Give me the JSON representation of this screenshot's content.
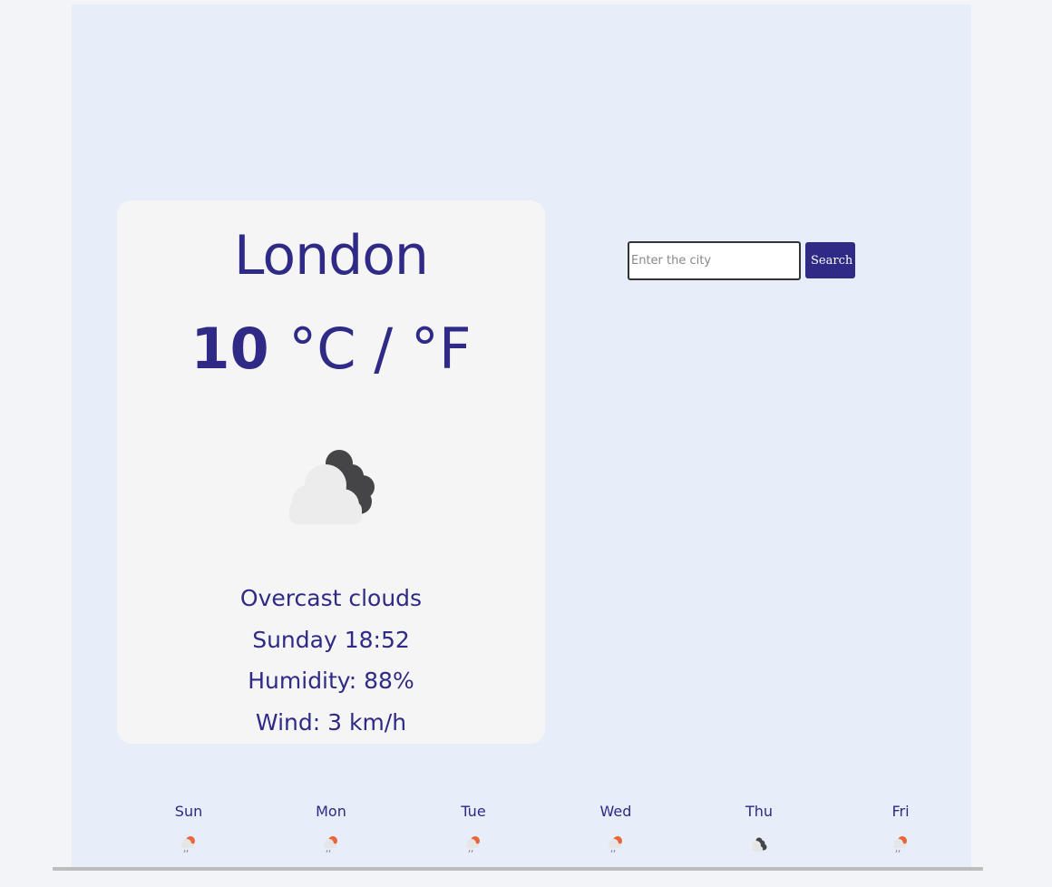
{
  "current": {
    "city": "London",
    "temperature": "10",
    "units": "°C / °F",
    "description": "Overcast clouds",
    "datetime": "Sunday 18:52",
    "humidity": "Humidity: 88%",
    "wind": "Wind: 3 km/h",
    "icon": "cloud-moon-icon"
  },
  "search": {
    "placeholder": "Enter the city",
    "value": "",
    "button_label": "Search"
  },
  "forecast": [
    {
      "day": "Sun",
      "icon": "rain-sun-icon"
    },
    {
      "day": "Mon",
      "icon": "rain-sun-icon"
    },
    {
      "day": "Tue",
      "icon": "rain-sun-icon"
    },
    {
      "day": "Wed",
      "icon": "rain-sun-icon"
    },
    {
      "day": "Thu",
      "icon": "cloud-moon-icon"
    },
    {
      "day": "Fri",
      "icon": "rain-sun-icon"
    }
  ],
  "colors": {
    "accent": "#2e2a86",
    "app_background": "#e7edf9",
    "card_background": "#f5f5f5",
    "sun": "#e8663c"
  }
}
